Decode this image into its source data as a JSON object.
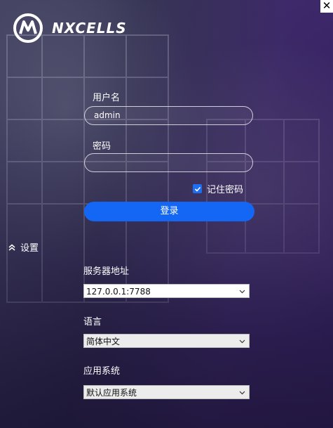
{
  "window": {
    "close_label": "✕"
  },
  "brand": {
    "name": "NXCELLS"
  },
  "login": {
    "username_label": "用户名",
    "username_value": "admin",
    "password_label": "密码",
    "password_value": "",
    "remember_label": "记住密码",
    "remember_checked": true,
    "login_button": "登录"
  },
  "settings": {
    "toggle_label": "设置",
    "server_label": "服务器地址",
    "server_value": "127.0.0.1:7788",
    "language_label": "语言",
    "language_value": "简体中文",
    "app_system_label": "应用系统",
    "app_system_value": "默认应用系统"
  },
  "colors": {
    "accent": "#1467f5"
  }
}
